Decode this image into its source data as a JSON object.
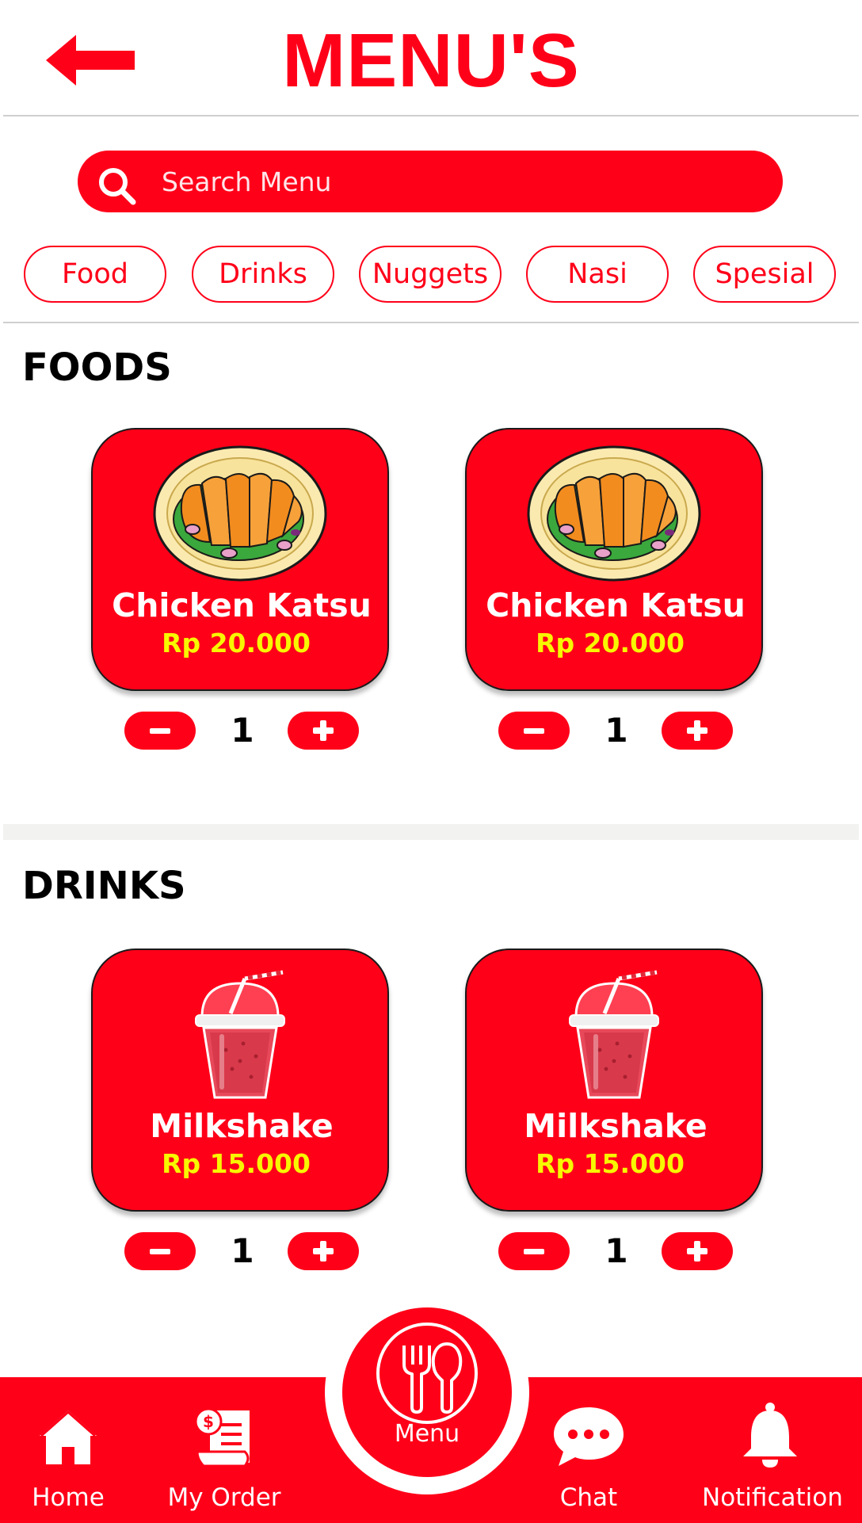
{
  "header": {
    "title": "MENU'S"
  },
  "search": {
    "placeholder": "Search Menu",
    "value": ""
  },
  "categories": [
    "Food",
    "Drinks",
    "Nuggets",
    "Nasi",
    "Spesial"
  ],
  "sections": [
    {
      "title": "FOODS",
      "items": [
        {
          "name": "Chicken Katsu",
          "price": "Rp 20.000",
          "qty": "1",
          "icon": "chicken-katsu-plate-icon"
        },
        {
          "name": "Chicken Katsu",
          "price": "Rp 20.000",
          "qty": "1",
          "icon": "chicken-katsu-plate-icon"
        }
      ]
    },
    {
      "title": "DRINKS",
      "items": [
        {
          "name": "Milkshake",
          "price": "Rp 15.000",
          "qty": "1",
          "icon": "milkshake-cup-icon"
        },
        {
          "name": "Milkshake",
          "price": "Rp 15.000",
          "qty": "1",
          "icon": "milkshake-cup-icon"
        }
      ]
    }
  ],
  "nav": {
    "home": "Home",
    "orders": "My Order",
    "menu": "Menu",
    "chat": "Chat",
    "notification": "Notification"
  },
  "colors": {
    "primary": "#ff0019",
    "price": "#f7f700",
    "background": "#ffffff"
  }
}
